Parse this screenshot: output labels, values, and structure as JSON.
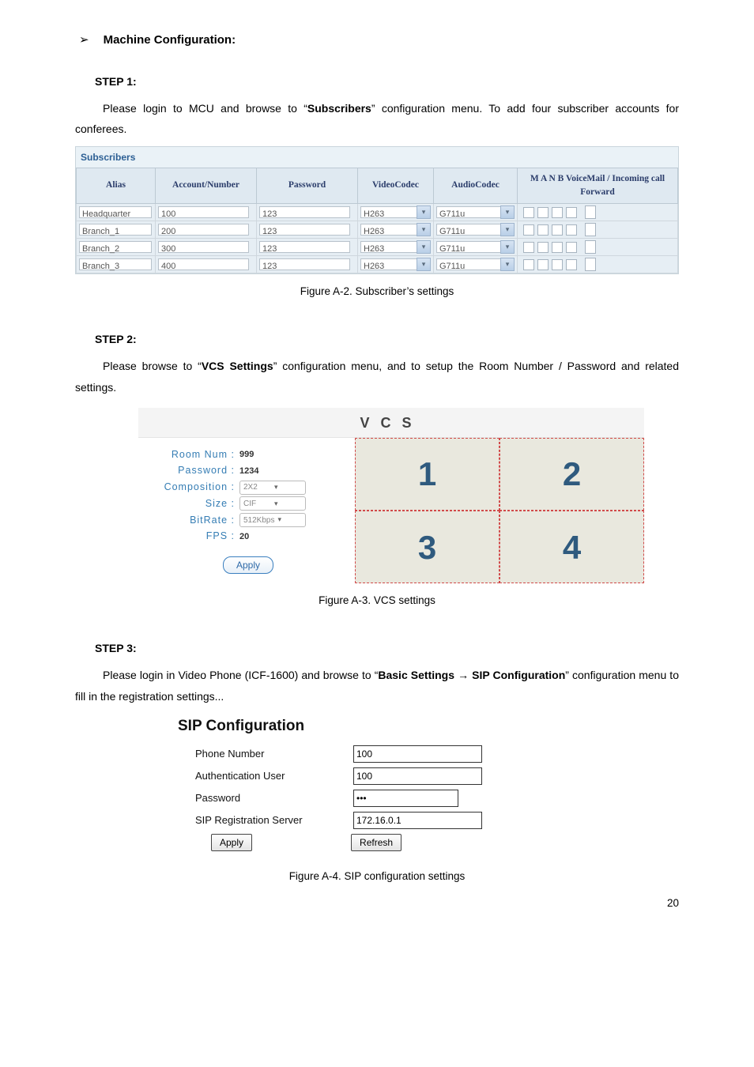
{
  "heading": "Machine Configuration:",
  "step1": {
    "label": "STEP 1:",
    "text_before": "Please login to MCU and browse to “",
    "text_bold": "Subscribers",
    "text_after": "” configuration menu. To add four subscriber accounts for conferees."
  },
  "subs": {
    "title": "Subscribers",
    "headers": [
      "Alias",
      "Account/Number",
      "Password",
      "VideoCodec",
      "AudioCodec",
      "M A N B VoiceMail / Incoming call Forward"
    ],
    "rows": [
      {
        "alias": "Headquarter",
        "num": "100",
        "pass": "123",
        "vc": "H263",
        "ac": "G711u"
      },
      {
        "alias": "Branch_1",
        "num": "200",
        "pass": "123",
        "vc": "H263",
        "ac": "G711u"
      },
      {
        "alias": "Branch_2",
        "num": "300",
        "pass": "123",
        "vc": "H263",
        "ac": "G711u"
      },
      {
        "alias": "Branch_3",
        "num": "400",
        "pass": "123",
        "vc": "H263",
        "ac": "G711u"
      }
    ],
    "caption": "Figure A-2. Subscriber’s settings"
  },
  "step2": {
    "label": "STEP 2:",
    "text_before": "Please browse to “",
    "text_bold": "VCS Settings",
    "text_after": "” configuration menu, and to setup the Room Number / Password and related settings."
  },
  "vcs": {
    "head": "VCS",
    "room_label": "Room Num :",
    "room_val": "999",
    "pass_label": "Password :",
    "pass_val": "1234",
    "comp_label": "Composition :",
    "comp_val": "2X2",
    "size_label": "Size :",
    "size_val": "CIF",
    "rate_label": "BitRate :",
    "rate_val": "512Kbps",
    "fps_label": "FPS :",
    "fps_val": "20",
    "apply": "Apply",
    "cells": [
      "1",
      "2",
      "3",
      "4"
    ],
    "caption": "Figure A-3. VCS settings"
  },
  "step3": {
    "label": "STEP 3:",
    "text_before": "Please login in Video Phone (ICF-1600) and browse to “",
    "text_bold": "Basic Settings → SIP Configuration",
    "text_after": "” configuration menu to fill in the registration settings..."
  },
  "sip": {
    "title": "SIP Configuration",
    "phone_label": "Phone Number",
    "phone_val": "100",
    "auth_label": "Authentication User",
    "auth_val": "100",
    "pass_label": "Password",
    "pass_val": "•••",
    "srv_label": "SIP Registration Server",
    "srv_val": "172.16.0.1",
    "apply": "Apply",
    "refresh": "Refresh",
    "caption": "Figure A-4. SIP configuration settings"
  },
  "page_number": "20"
}
